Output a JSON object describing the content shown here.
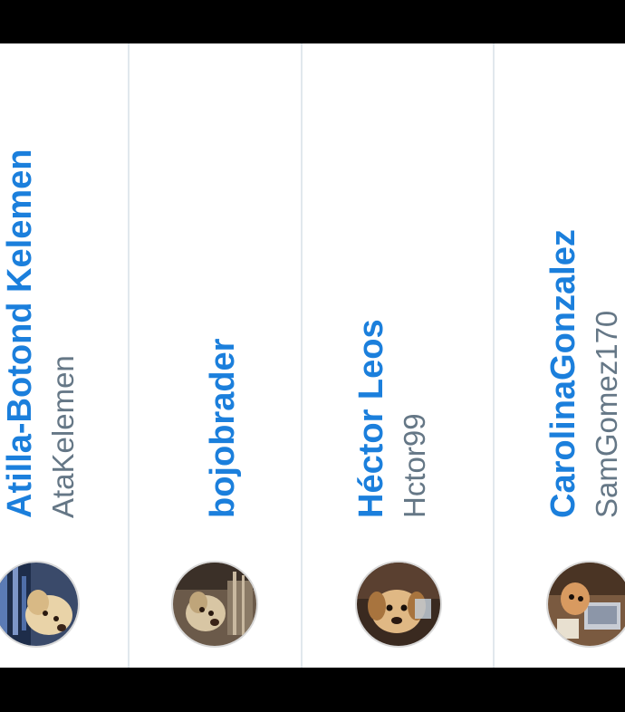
{
  "accent_color": "#1b7fdc",
  "secondary_text_color": "#657786",
  "users": [
    {
      "display_name": "Atilla-Botond Kelemen",
      "handle": "AtaKelemen",
      "avatar": "dog-avatar-icon"
    },
    {
      "display_name": "bojobrader",
      "handle": "",
      "avatar": "dog-avatar-icon"
    },
    {
      "display_name": "Héctor Leos",
      "handle": "Hctor99",
      "avatar": "dog-avatar-icon"
    },
    {
      "display_name": "CarolinaGonzalez",
      "handle": "SamGomez170",
      "avatar": "dog-avatar-icon"
    }
  ]
}
